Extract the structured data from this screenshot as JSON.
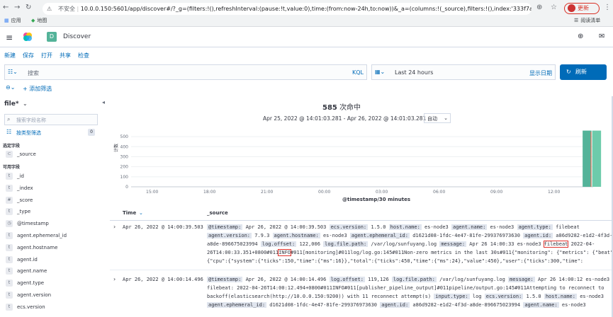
{
  "browser": {
    "insecure_label": "不安全",
    "url": "10.0.0.150:5601/app/discover#/?_g=(filters:!(),refreshInterval:(pause:!t,value:0),time:(from:now-24h,to:now))&_a=(columns:!(_source),filters:!(),index:'333f7a70-c526-1...",
    "update_label": "更新",
    "bookmarks": [
      "应用",
      "地图"
    ],
    "reading_list": "阅读清单"
  },
  "app": {
    "badge": "D",
    "title": "Discover"
  },
  "menu": [
    "新建",
    "保存",
    "打开",
    "共享",
    "检查"
  ],
  "query": {
    "placeholder": "搜索",
    "kql": "KQL",
    "time_range": "Last 24 hours",
    "show_dates": "显示日期",
    "refresh": "刷新"
  },
  "filter": {
    "add": "+ 添加筛选"
  },
  "sidebar": {
    "index": "file*",
    "search_placeholder": "搜索字段名称",
    "filter_by_type": "按类型筛选",
    "filter_count": "0",
    "selected_header": "选定字段",
    "selected": [
      {
        "type": "⊂",
        "name": "_source"
      }
    ],
    "available_header": "可用字段",
    "fields": [
      {
        "type": "t",
        "name": "_id"
      },
      {
        "type": "t",
        "name": "_index"
      },
      {
        "type": "#",
        "name": "_score"
      },
      {
        "type": "t",
        "name": "_type"
      },
      {
        "type": "◷",
        "name": "@timestamp"
      },
      {
        "type": "t",
        "name": "agent.ephemeral_id"
      },
      {
        "type": "t",
        "name": "agent.hostname"
      },
      {
        "type": "t",
        "name": "agent.id"
      },
      {
        "type": "t",
        "name": "agent.name"
      },
      {
        "type": "t",
        "name": "agent.type"
      },
      {
        "type": "t",
        "name": "agent.version"
      },
      {
        "type": "t",
        "name": "ecs.version"
      }
    ]
  },
  "hits": {
    "count": "585",
    "label": "次命中",
    "range": "Apr 25, 2022 @ 14:01:03.281 - Apr 26, 2022 @ 14:01:03.281",
    "interval": "自动"
  },
  "chart_data": {
    "type": "bar",
    "xlabel": "@timestamp/30 minutes",
    "ylabel": "计数",
    "x_ticks": [
      "15:00",
      "18:00",
      "21:00",
      "00:00",
      "03:00",
      "06:00",
      "09:00",
      "12:00"
    ],
    "y_ticks": [
      "0",
      "100",
      "200",
      "300",
      "400",
      "500"
    ],
    "ylim": [
      0,
      550
    ],
    "bars": [
      {
        "x": "13:30",
        "value": 560
      },
      {
        "x": "14:00",
        "value": 560
      }
    ]
  },
  "table": {
    "col_time": "Time",
    "col_source": "_source",
    "rows": [
      {
        "time": "Apr 26, 2022 @ 14:00:39.503"
      },
      {
        "time": "Apr 26, 2022 @ 14:00:14.496"
      }
    ],
    "r1": {
      "l1": [
        [
          "@timestamp:",
          "Apr 26, 2022 @ 14:00:39.503"
        ],
        [
          "ecs.version:",
          "1.5.0"
        ],
        [
          "host.name:",
          "es-node3"
        ],
        [
          "agent.name:",
          "es-node3"
        ],
        [
          "agent.type:",
          "filebeat"
        ]
      ],
      "l2": [
        [
          "agent.version:",
          "7.9.3"
        ],
        [
          "agent.hostname:",
          "es-node3"
        ],
        [
          "agent.ephemeral_id:",
          "d1621d08-1fdc-4e47-81fe-299376973630"
        ],
        [
          "agent.id:",
          "a86d9282-e1d2-4f3d-"
        ]
      ],
      "l3a": "a8de-896675023994",
      "l3": [
        [
          "log.offset:",
          "122,006"
        ],
        [
          "log.file.path:",
          "/var/log/sunfuyang.log"
        ]
      ],
      "l3m": "message:",
      "l3v": "Apr 26 14:00:33 es-node3",
      "l3h": "filebeat",
      "l3t": "2022-04-",
      "l4a": "26T14:00:33.351+0800#011",
      "l4h": "INFO",
      "l4b": "#011[monitoring]#011log/log.go:145#011Non-zero metrics in the last 30s#011{\"monitoring\": {\"metrics\": {\"beat\":",
      "l5": "{\"cpu\":{\"system\":{\"ticks\":150,\"time\":{\"ms\":16}},\"total\":{\"ticks\":450,\"time\":{\"ms\":24},\"value\":450},\"user\":{\"ticks\":300,\"time\":"
    },
    "r2": {
      "l1": [
        [
          "@timestamp:",
          "Apr 26, 2022 @ 14:00:14.496"
        ],
        [
          "log.offset:",
          "119,126"
        ],
        [
          "log.file.path:",
          "/var/log/sunfuyang.log"
        ],
        [
          "message:",
          "Apr 26 14:00:12 es-node3"
        ]
      ],
      "l2": "filebeat: 2022-04-26T14:00:12.494+0800#011INFO#011[publisher_pipeline_output]#011pipeline/output.go:145#011Attempting to reconnect to",
      "l3": "backoff(elasticsearch(http://10.0.0.150:9200)) with 11 reconnect attempt(s)",
      "l3k": [
        [
          "input.type:",
          "log"
        ],
        [
          "ecs.version:",
          "1.5.0"
        ],
        [
          "host.name:",
          "es-node3"
        ]
      ],
      "l4": [
        [
          "agent.ephemeral_id:",
          "d1621d08-1fdc-4e47-81fe-299376973630"
        ],
        [
          "agent.id:",
          "a86d9282-e1d2-4f3d-a8de-896675023994"
        ],
        [
          "agent.name:",
          "es-node3"
        ]
      ]
    }
  }
}
